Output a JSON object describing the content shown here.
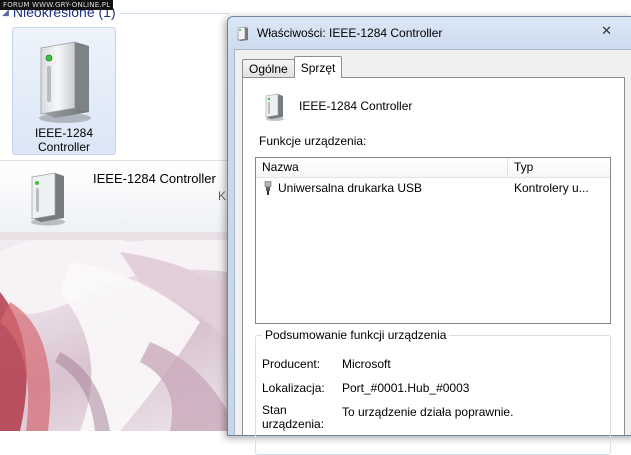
{
  "watermark": "FORUM WWW.GRY-ONLINE.PL",
  "background_window": {
    "group_header": "Nieokreślone (1)",
    "tile_label": "IEEE-1284 Controller",
    "details_name": "IEEE-1284 Controller",
    "details_truncated": "K"
  },
  "dialog": {
    "title": "Właściwości: IEEE-1284 Controller",
    "tabs": [
      {
        "label": "Ogólne",
        "active": false
      },
      {
        "label": "Sprzęt",
        "active": true
      }
    ],
    "device_name": "IEEE-1284 Controller",
    "functions_label": "Funkcje urządzenia:",
    "list_columns": [
      "Nazwa",
      "Typ"
    ],
    "list_rows": [
      {
        "name": "Uniwersalna drukarka USB",
        "type": "Kontrolery u..."
      }
    ],
    "summary": {
      "title": "Podsumowanie funkcji urządzenia",
      "producer_label": "Producent:",
      "producer_value": "Microsoft",
      "location_label": "Lokalizacja:",
      "location_value": "Port_#0001.Hub_#0003",
      "status_label_1": "Stan",
      "status_label_2": "urządzenia:",
      "status_value": "To urządzenie działa poprawnie."
    }
  }
}
